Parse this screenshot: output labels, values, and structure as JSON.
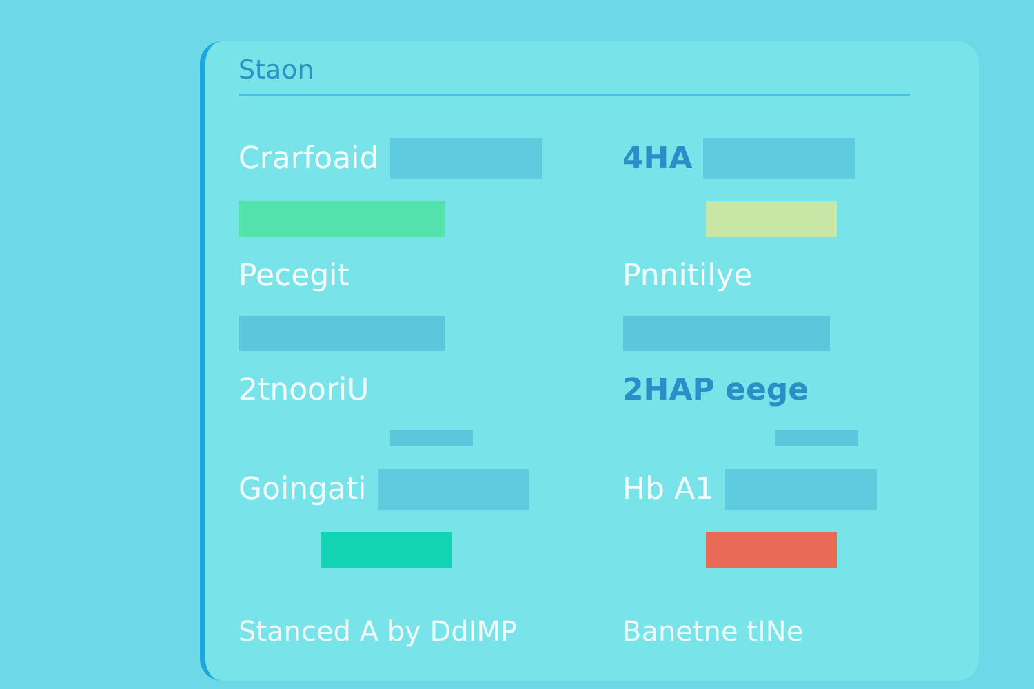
{
  "title": "Staon",
  "columns": [
    {
      "rows": [
        {
          "kind": "label",
          "text": "Crarfoaid",
          "field": true
        },
        {
          "kind": "wide-bar",
          "color": "#52e3ad"
        },
        {
          "kind": "label",
          "text": "Pecegit",
          "field": false
        },
        {
          "kind": "wide-bar",
          "color": "#5bc6dc"
        },
        {
          "kind": "label",
          "text": "2tnooriU",
          "field": false
        },
        {
          "kind": "short-bar",
          "color": "#5bc6dc"
        },
        {
          "kind": "label",
          "text": "Goingati",
          "field": true
        },
        {
          "kind": "mid-bar",
          "color": "#12d4b4"
        }
      ],
      "footer": "Stanced A by DdIMP"
    },
    {
      "rows": [
        {
          "kind": "accent",
          "text": "4HA",
          "field": true
        },
        {
          "kind": "mid-bar",
          "color": "#c8e6a6"
        },
        {
          "kind": "label",
          "text": "Pnnitilye",
          "field": false
        },
        {
          "kind": "wide-bar",
          "color": "#5bc6dc"
        },
        {
          "kind": "accent",
          "text": "2HAP eege",
          "field": false
        },
        {
          "kind": "short-bar",
          "color": "#5bc6dc"
        },
        {
          "kind": "label",
          "text": "Hb A1",
          "field": true
        },
        {
          "kind": "mid-bar",
          "color": "#ea6b55"
        }
      ],
      "footer": "Banetne tINe"
    }
  ]
}
